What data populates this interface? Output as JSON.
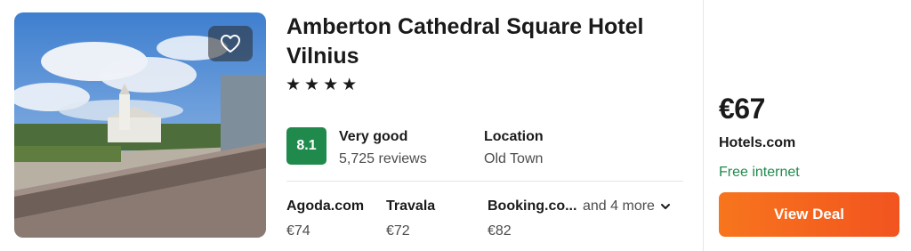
{
  "hotel": {
    "name": "Amberton Cathedral Square Hotel Vilnius",
    "stars_display": "★★★★",
    "star_count": 4
  },
  "rating": {
    "score": "8.1",
    "label": "Very good",
    "reviews": "5,725 reviews"
  },
  "location": {
    "label": "Location",
    "value": "Old Town"
  },
  "providers": [
    {
      "name": "Agoda.com",
      "price": "€74"
    },
    {
      "name": "Travala",
      "price": "€72"
    },
    {
      "name": "Booking.co...",
      "price": "€82"
    }
  ],
  "more_label": "and 4 more",
  "deal": {
    "price": "€67",
    "site": "Hotels.com",
    "perk": "Free internet",
    "button_label": "View Deal"
  },
  "colors": {
    "score_badge": "#1f8a4c",
    "perk_text": "#1f8a4c",
    "deal_button": "#f2541f"
  },
  "icons": {
    "favorite": "heart-outline-icon",
    "more": "chevron-down-icon"
  }
}
